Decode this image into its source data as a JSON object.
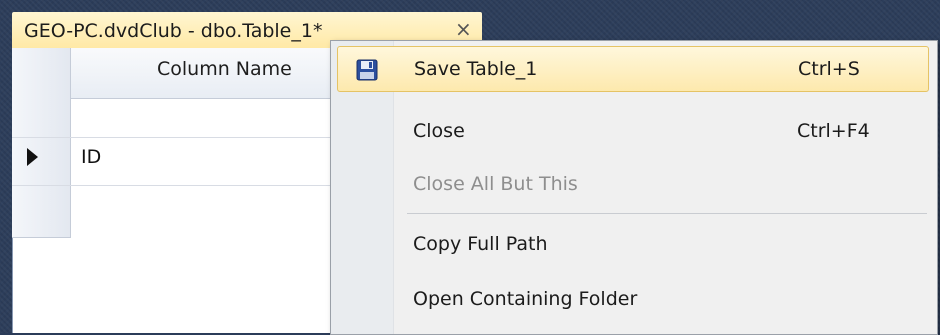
{
  "document_tab": {
    "title": "GEO-PC.dvdClub - dbo.Table_1*",
    "close_glyph": "×"
  },
  "grid": {
    "column_header": "Column Name",
    "rows": [
      {
        "value": "ID",
        "current": true
      },
      {
        "value": ""
      }
    ]
  },
  "context_menu": {
    "items": [
      {
        "label": "Save Table_1",
        "shortcut": "Ctrl+S",
        "icon": "save-icon",
        "highlighted": true
      },
      {
        "label": "Close",
        "shortcut": "Ctrl+F4"
      },
      {
        "label": "Close All But This",
        "shortcut": "",
        "disabled": true
      },
      {
        "label": "Copy Full Path",
        "shortcut": ""
      },
      {
        "label": "Open Containing Folder",
        "shortcut": ""
      }
    ]
  },
  "colors": {
    "accent_highlight": "#fde9ad",
    "tab_active": "#ffe9a6",
    "ide_background": "#2c3d5a"
  }
}
